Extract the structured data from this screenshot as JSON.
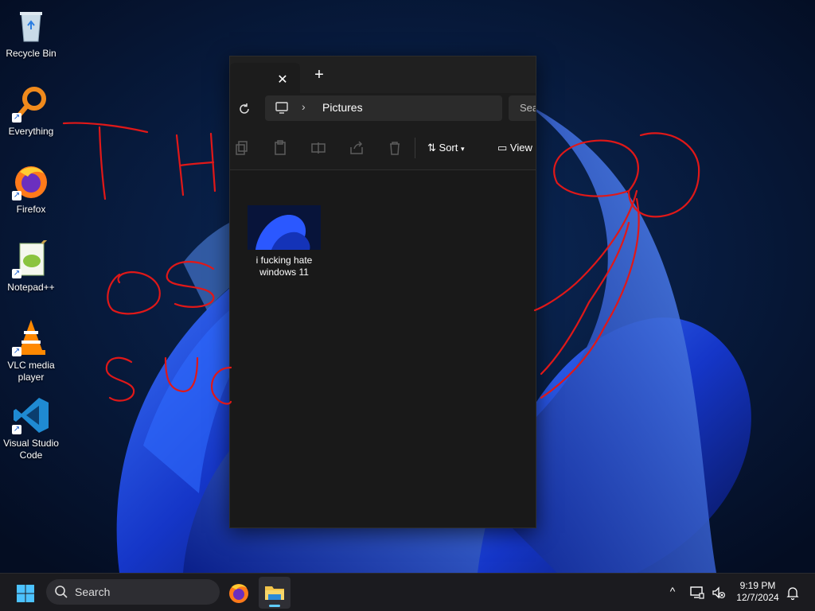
{
  "desktop": {
    "icons": [
      {
        "label": "Recycle Bin",
        "icon": "recycle-bin-icon"
      },
      {
        "label": "Everything",
        "icon": "everything-search-icon"
      },
      {
        "label": "Firefox",
        "icon": "firefox-icon"
      },
      {
        "label": "Notepad++",
        "icon": "notepad-plus-plus-icon"
      },
      {
        "label": "VLC media player",
        "icon": "vlc-icon"
      },
      {
        "label": "Visual Studio Code",
        "icon": "vscode-icon"
      }
    ]
  },
  "explorer": {
    "tab_close": "✕",
    "tab_add": "+",
    "breadcrumb": "Pictures",
    "search_placeholder": "Sea",
    "sort_label": "Sort",
    "view_label": "View",
    "files": [
      {
        "name": "i fucking hate windows 11"
      }
    ]
  },
  "taskbar": {
    "search_label": "Search",
    "time": "9:19 PM",
    "date": "12/7/2024",
    "accent": "#60cdff"
  }
}
